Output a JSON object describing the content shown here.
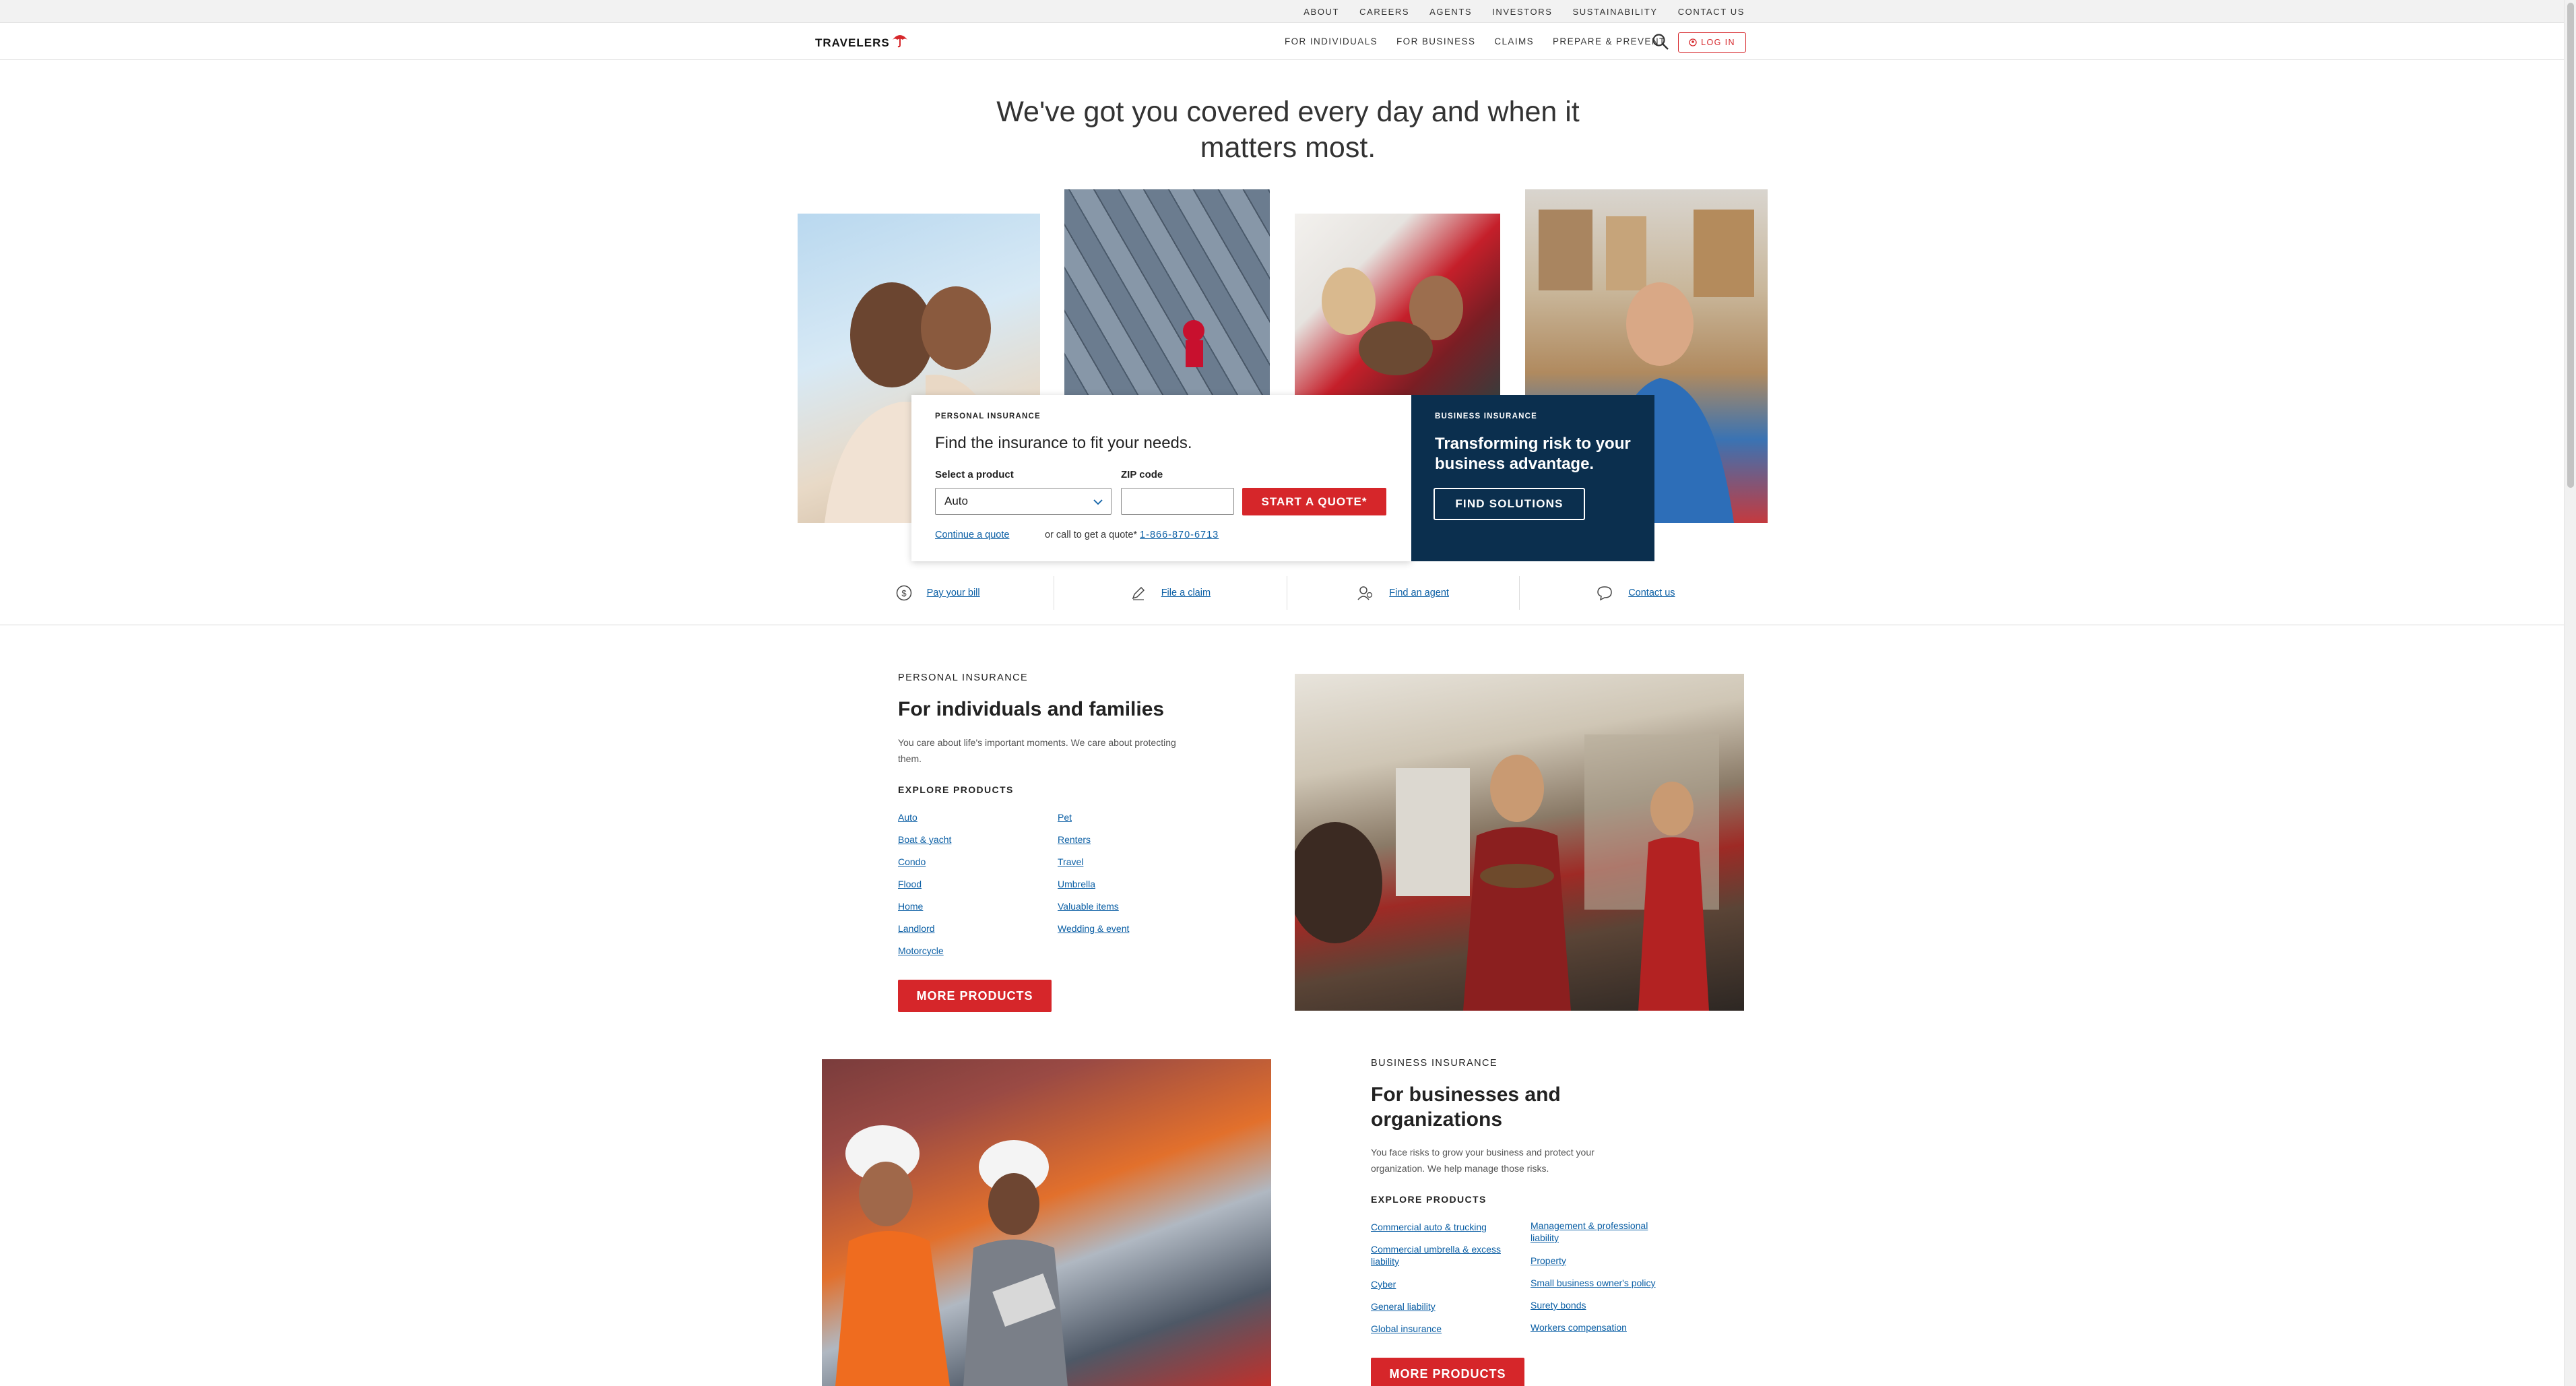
{
  "utility_nav": [
    "ABOUT",
    "CAREERS",
    "AGENTS",
    "INVESTORS",
    "SUSTAINABILITY",
    "CONTACT US"
  ],
  "header": {
    "logo_text": "TRAVELERS",
    "nav": [
      "FOR INDIVIDUALS",
      "FOR BUSINESS",
      "CLAIMS",
      "PREPARE & PREVENT"
    ],
    "login_label": "LOG IN",
    "icons": {
      "search": "search-icon",
      "login": "user-icon",
      "logo": "umbrella-icon"
    }
  },
  "hero": {
    "title": "We've got you covered every day and when it matters most."
  },
  "quote_card": {
    "eyebrow": "PERSONAL INSURANCE",
    "heading": "Find the insurance to fit your needs.",
    "product_label": "Select a product",
    "product_value": "Auto",
    "zip_label": "ZIP code",
    "zip_value": "",
    "cta": "START A QUOTE*",
    "continue_link": "Continue a quote",
    "call_text": "or call to get a quote*",
    "phone": "1-866-870-6713"
  },
  "business_card": {
    "eyebrow": "BUSINESS INSURANCE",
    "heading": "Transforming risk to your business advantage.",
    "cta": "FIND SOLUTIONS"
  },
  "quick_links": [
    {
      "label": "Pay your bill",
      "icon": "dollar-icon"
    },
    {
      "label": "File a claim",
      "icon": "pencil-icon"
    },
    {
      "label": "Find an agent",
      "icon": "agent-icon"
    },
    {
      "label": "Contact us",
      "icon": "chat-icon"
    }
  ],
  "personal": {
    "eyebrow": "PERSONAL INSURANCE",
    "heading": "For individuals and families",
    "description": "You care about life's important moments. We care about protecting them.",
    "explore_label": "EXPLORE PRODUCTS",
    "col1": [
      "Auto",
      "Boat & yacht",
      "Condo",
      "Flood",
      "Home",
      "Landlord",
      "Motorcycle"
    ],
    "col2": [
      "Pet",
      "Renters",
      "Travel",
      "Umbrella",
      "Valuable items",
      "Wedding & event"
    ],
    "cta": "MORE PRODUCTS"
  },
  "business": {
    "eyebrow": "BUSINESS INSURANCE",
    "heading": "For businesses and organizations",
    "description": "You face risks to grow your business and protect your organization. We help manage those risks.",
    "explore_label": "EXPLORE PRODUCTS",
    "col1": [
      "Commercial auto & trucking",
      "Commercial umbrella & excess liability",
      "Cyber",
      "General liability",
      "Global insurance"
    ],
    "col2": [
      "Management & professional liability",
      "Property",
      "Small business owner's policy",
      "Surety bonds",
      "Workers compensation"
    ],
    "cta": "MORE PRODUCTS"
  },
  "colors": {
    "brand_red": "#d6262a",
    "navy": "#0b2f4e",
    "link_blue": "#0b5fa5"
  }
}
